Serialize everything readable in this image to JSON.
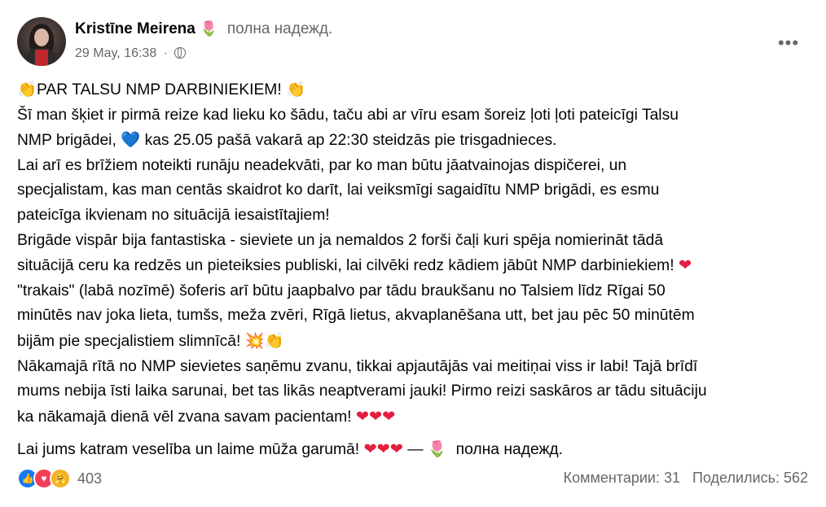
{
  "post": {
    "author": "Kristīne Meirena",
    "feeling": "полна надежд.",
    "timestamp": "29 May, 16:38",
    "dot": "·",
    "more": "•••",
    "lines": [
      "PAR TALSU NMP DARBINIEKIEM!",
      "Šī man šķiet ir pirmā reize kad lieku ko šādu, taču abi ar vīru esam šoreiz ļoti ļoti pateicīgi Talsu",
      "NMP brigādei,",
      "kas 25.05 pašā vakarā ap 22:30 steidzās pie trisgadnieces.",
      "Lai arī es brīžiem noteikti runāju neadekvāti, par ko man būtu jāatvainojas dispičerei, un",
      "specjalistam, kas man centās skaidrot ko darīt, lai veiksmīgi sagaidītu NMP brigādi, es esmu",
      "pateicīga ikvienam no situācijā iesaistītajiem!",
      "Brigāde vispār bija fantastiska - sieviete un ja nemaldos 2 forši čaļi kuri spēja nomierināt tādā",
      "situācijā ceru ka redzēs un pieteiksies publiski, lai cilvēki redz kādiem jābūt NMP darbiniekiem!",
      "\"trakais\" (labā nozīmē) šoferis arī būtu jaapbalvo par tādu braukšanu no Talsiem līdz Rīgai 50",
      "minūtēs nav joka lieta, tumšs, meža zvēri, Rīgā lietus, akvaplanēšana utt, bet jau pēc 50 minūtēm",
      "bijām pie specjalistiem slimnīcā!",
      "Nākamajā rītā no NMP sievietes saņēmu zvanu, tikkai apjautājās vai meitiņai viss ir labi! Tajā brīdī",
      "mums nebija īsti laika sarunai, bet tas likās neaptverami jauki! Pirmo reizi saskāros ar tādu situāciju",
      "ka nākamajā dienā vēl zvana savam pacientam!",
      "Lai jums katram veselība un laime mūža garumā!",
      "—",
      "полна надежд."
    ],
    "emoji": {
      "clap": "👏",
      "blue_heart": "💙",
      "red_heart": "❤",
      "three_hearts": "❤❤❤",
      "boom": "💥",
      "tulip": "🌷"
    }
  },
  "footer": {
    "reaction_count": "403",
    "comments": "Комментарии: 31",
    "shares": "Поделились: 562"
  },
  "colors": {
    "primary_text": "#050505",
    "secondary_text": "#65676b",
    "like_blue": "#1877f2",
    "love_red": "#f33e58",
    "care_yellow": "#f7b125"
  }
}
